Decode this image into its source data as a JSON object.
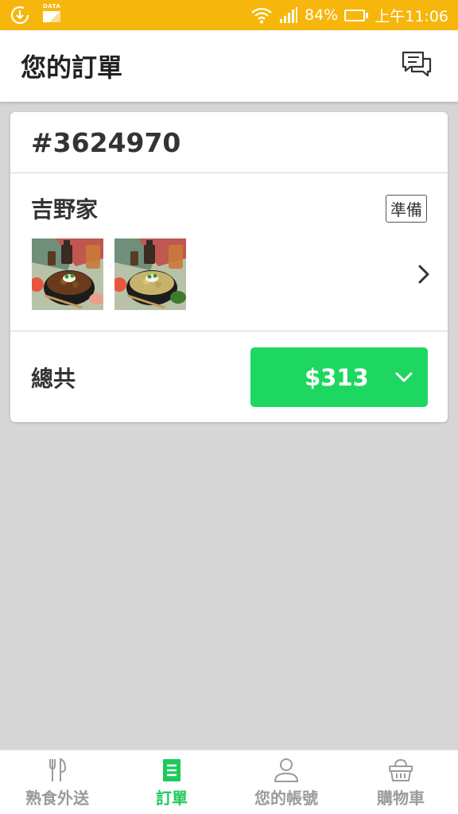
{
  "status_bar": {
    "data_label": "DATA",
    "battery": "84%",
    "battery_level": 0.84,
    "time": "上午11:06"
  },
  "header": {
    "title": "您的訂單",
    "chat_icon": "chat-bubbles-icon"
  },
  "order": {
    "id": "#3624970",
    "restaurant": "吉野家",
    "status": "準備",
    "item_images": [
      "beef-bowl-photo",
      "chicken-bowl-photo"
    ],
    "total_label": "總共",
    "total_amount": "$313"
  },
  "bottom_nav": {
    "items": [
      {
        "label": "熟食外送",
        "icon": "fork-knife-icon",
        "active": false
      },
      {
        "label": "訂單",
        "icon": "receipt-icon",
        "active": true
      },
      {
        "label": "您的帳號",
        "icon": "person-icon",
        "active": false
      },
      {
        "label": "購物車",
        "icon": "basket-icon",
        "active": false
      }
    ]
  },
  "colors": {
    "status_bar": "#f6b60c",
    "accent_green": "#1ed761",
    "nav_active": "#1ec95a",
    "background": "#d6d6d6"
  }
}
